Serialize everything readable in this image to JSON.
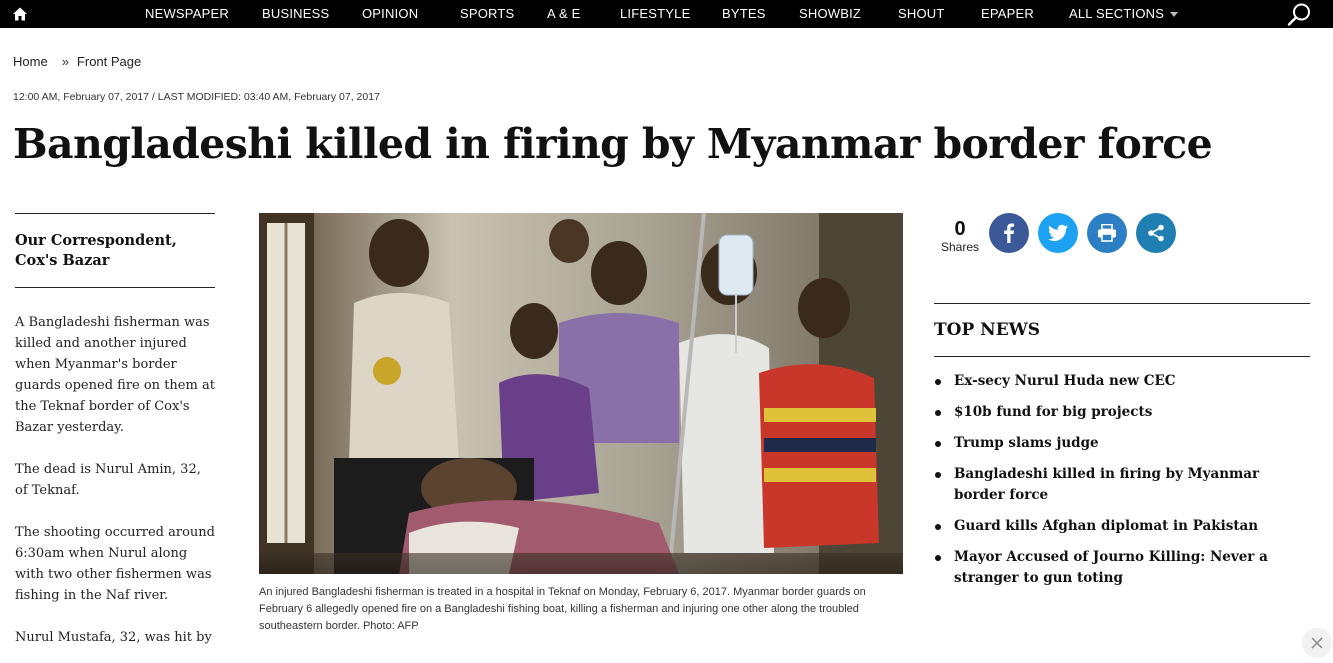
{
  "nav": {
    "items": [
      "NEWSPAPER",
      "BUSINESS",
      "OPINION",
      "SPORTS",
      "A & E",
      "LIFESTYLE",
      "BYTES",
      "SHOWBIZ",
      "SHOUT",
      "EPAPER"
    ],
    "all_sections": "ALL SECTIONS"
  },
  "breadcrumb": {
    "home": "Home",
    "separator": "»",
    "current": "Front Page"
  },
  "article": {
    "dateline": "12:00 AM, February 07, 2017 / LAST MODIFIED: 03:40 AM, February 07, 2017",
    "headline": "Bangladeshi killed in firing by Myanmar border force",
    "author_line1": "Our Correspondent,",
    "author_line2": "Cox's Bazar",
    "paragraphs": [
      "A Bangladeshi fisherman was killed and another injured when Myanmar's border guards opened fire on them at the Teknaf border of Cox's Bazar yesterday.",
      "The dead is Nurul Amin, 32, of Teknaf.",
      "The shooting occurred around 6:30am when Nurul along with two other fishermen was fishing in the Naf river.",
      "Nurul Mustafa, 32, was hit by"
    ],
    "caption": "An injured Bangladeshi fisherman is treated in a hospital in Teknaf on Monday, February 6, 2017. Myanmar border guards on February 6 allegedly opened fire on a Bangladeshi fishing boat, killing a fisherman and injuring one other along the troubled southeastern border. Photo: AFP"
  },
  "share": {
    "count": "0",
    "label": "Shares",
    "buttons": [
      {
        "icon": "facebook-icon",
        "color": "#3b5998"
      },
      {
        "icon": "twitter-icon",
        "color": "#1da1f2"
      },
      {
        "icon": "print-icon",
        "color": "#2c7fc4"
      },
      {
        "icon": "share-icon",
        "color": "#1f7fb3"
      }
    ]
  },
  "top_news": {
    "title": "TOP NEWS",
    "items": [
      "Ex-secy Nurul Huda new CEC",
      "$10b fund for big projects",
      "Trump slams judge",
      "Bangladeshi killed in firing by Myanmar border force",
      "Guard kills Afghan diplomat in Pakistan",
      "Mayor Accused of Journo Killing: Never a stranger to gun toting"
    ]
  },
  "colors": {
    "nav_bg": "#000000",
    "nav_text": "#ffffff"
  }
}
